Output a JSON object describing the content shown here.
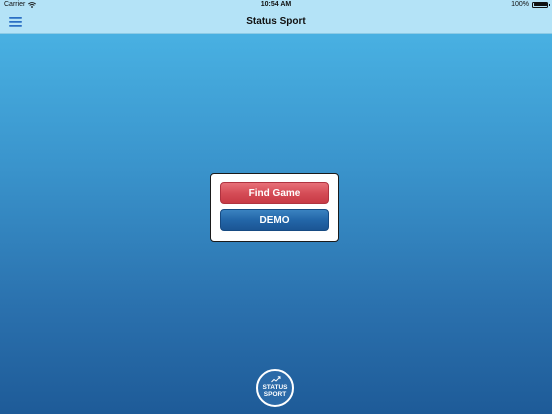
{
  "status_bar": {
    "carrier": "Carrier",
    "time": "10:54 AM",
    "battery": "100%",
    "battery_level": 1.0
  },
  "nav": {
    "title": "Status Sport"
  },
  "panel": {
    "find_game_label": "Find Game",
    "demo_label": "DEMO"
  },
  "logo": {
    "line1": "STATUS",
    "line2": "SPORT"
  },
  "icons": {
    "menu": "hamburger-menu-icon",
    "wifi": "wifi-icon",
    "battery": "battery-icon",
    "logo_chart": "trend-line-icon"
  },
  "colors": {
    "nav_background": "#b4e3f7",
    "find_game_button": "#d54d57",
    "demo_button": "#2366a8",
    "background_top": "#4cb8e8",
    "background_bottom": "#1e5b98"
  }
}
